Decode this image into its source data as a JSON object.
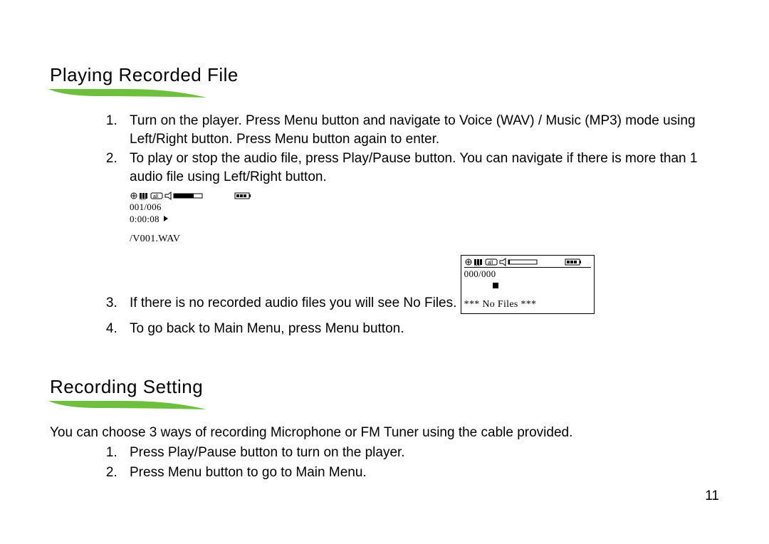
{
  "section1": {
    "heading": "Playing Recorded File",
    "steps": {
      "s1": "Turn on the player. Press Menu button and navigate to Voice (WAV) / Music (MP3) mode using Left/Right button. Press Menu button again to enter.",
      "s2": "To play or stop the audio file, press Play/Pause button. You can navigate if there is more than 1 audio file using Left/Right button.",
      "s3": "If there is no recorded audio files you will see No Files.",
      "s4": "To go back to Main Menu, press Menu button."
    },
    "screen1": {
      "counter": "001/006",
      "time": "0:00:08",
      "filename": "/V001.WAV"
    },
    "screen2": {
      "counter": "000/000",
      "message": "*** No Files ***"
    }
  },
  "section2": {
    "heading": "Recording Setting",
    "intro": "You can choose 3 ways of recording Microphone or FM Tuner using the cable provided.",
    "steps": {
      "s1": "Press Play/Pause button to turn on the player.",
      "s2": "Press Menu button to go to Main Menu."
    }
  },
  "page_number": "11"
}
